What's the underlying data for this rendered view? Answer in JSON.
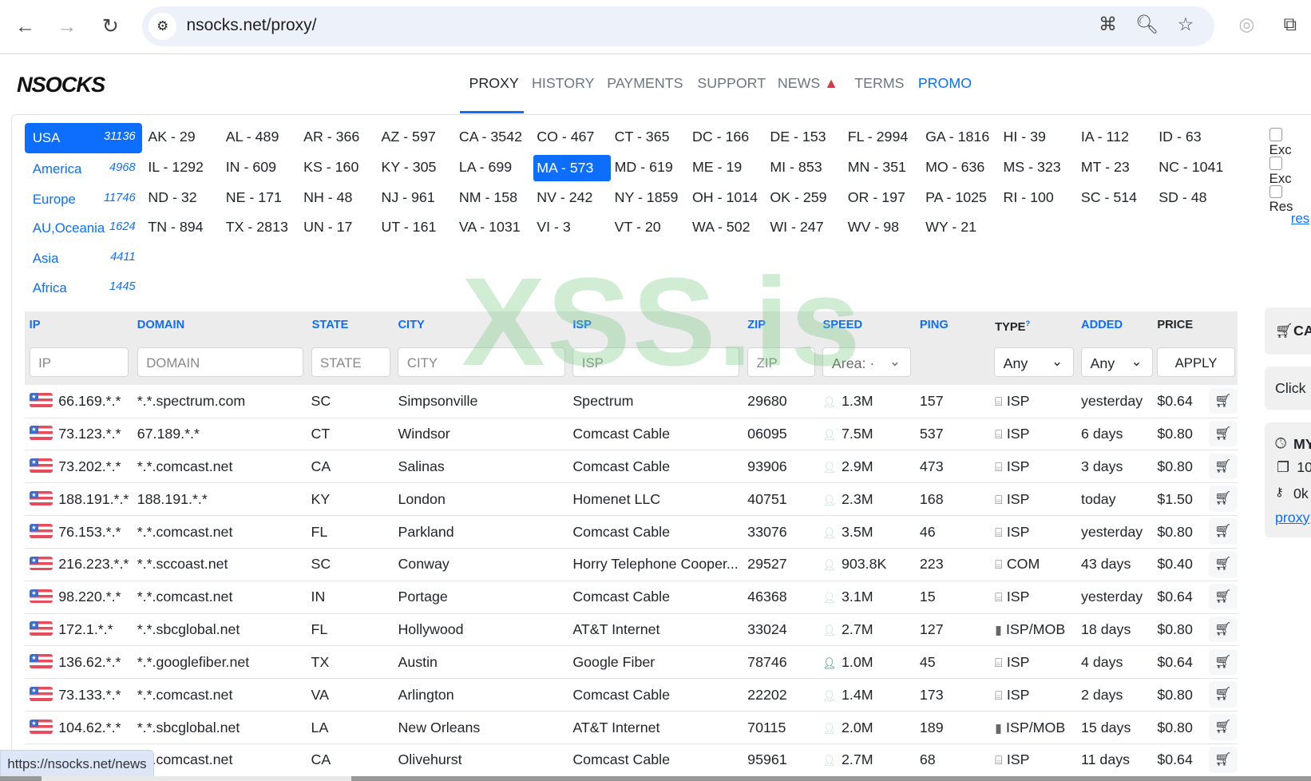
{
  "browser": {
    "url": "nsocks.net/proxy/",
    "status_url": "https://nsocks.net/news"
  },
  "site": {
    "logo": "NSOCKS",
    "nav": [
      "PROXY",
      "HISTORY",
      "PAYMENTS",
      "SUPPORT",
      "NEWS",
      "TERMS",
      "PROMO"
    ]
  },
  "regions": [
    {
      "name": "USA",
      "count": "31136"
    },
    {
      "name": "America",
      "count": "4968"
    },
    {
      "name": "Europe",
      "count": "11746"
    },
    {
      "name": "AU,Oceania",
      "count": "1624"
    },
    {
      "name": "Asia",
      "count": "4411"
    },
    {
      "name": "Africa",
      "count": "1445"
    }
  ],
  "states": [
    "AK - 29",
    "AL - 489",
    "AR - 366",
    "AZ - 597",
    "CA - 3542",
    "CO - 467",
    "CT - 365",
    "DC - 166",
    "DE - 153",
    "FL - 2994",
    "GA - 1816",
    "HI - 39",
    "IA - 112",
    "ID - 63",
    "IL - 1292",
    "IN - 609",
    "KS - 160",
    "KY - 305",
    "LA - 699",
    "MA - 573",
    "MD - 619",
    "ME - 19",
    "MI - 853",
    "MN - 351",
    "MO - 636",
    "MS - 323",
    "MT - 23",
    "NC - 1041",
    "ND - 32",
    "NE - 171",
    "NH - 48",
    "NJ - 961",
    "NM - 158",
    "NV - 242",
    "NY - 1859",
    "OH - 1014",
    "OK - 259",
    "OR - 197",
    "PA - 1025",
    "RI - 100",
    "SC - 514",
    "SD - 48",
    "TN - 894",
    "TX - 2813",
    "UN - 17",
    "UT - 161",
    "VA - 1031",
    "VI - 3",
    "VT - 20",
    "WA - 502",
    "WI - 247",
    "WV - 98",
    "WY - 21"
  ],
  "selected_state": "MA - 573",
  "options": [
    "Exc",
    "Exc",
    "Res"
  ],
  "reset_link": "res",
  "watermark": "XSS.is",
  "table": {
    "headers": {
      "ip": "IP",
      "domain": "DOMAIN",
      "state": "STATE",
      "city": "CITY",
      "isp": "ISP",
      "zip": "ZIP",
      "speed": "SPEED",
      "ping": "PING",
      "type": "TYPE",
      "type_sup": "?",
      "added": "ADDED",
      "price": "PRICE"
    },
    "filters": {
      "ip": "IP",
      "domain": "DOMAIN",
      "state": "STATE",
      "city": "CITY",
      "isp": "ISP",
      "zip": "ZIP",
      "speed": "Area: ·",
      "type": "Any",
      "added": "Any",
      "apply": "APPLY"
    },
    "rows": [
      {
        "ip": "66.169.*.*",
        "domain": "*.*.spectrum.com",
        "state": "SC",
        "city": "Simpsonville",
        "isp": "Spectrum",
        "zip": "29680",
        "speed": "1.3M",
        "ping": "157",
        "type": "ISP",
        "added": "yesterday",
        "price": "$0.64"
      },
      {
        "ip": "73.123.*.*",
        "domain": "67.189.*.*",
        "state": "CT",
        "city": "Windsor",
        "isp": "Comcast Cable",
        "zip": "06095",
        "speed": "7.5M",
        "ping": "537",
        "type": "ISP",
        "added": "6 days",
        "price": "$0.80"
      },
      {
        "ip": "73.202.*.*",
        "domain": "*.*.comcast.net",
        "state": "CA",
        "city": "Salinas",
        "isp": "Comcast Cable",
        "zip": "93906",
        "speed": "2.9M",
        "ping": "473",
        "type": "ISP",
        "added": "3 days",
        "price": "$0.80"
      },
      {
        "ip": "188.191.*.*",
        "domain": "188.191.*.*",
        "state": "KY",
        "city": "London",
        "isp": "Homenet LLC",
        "zip": "40751",
        "speed": "2.3M",
        "ping": "168",
        "type": "ISP",
        "added": "today",
        "price": "$1.50"
      },
      {
        "ip": "76.153.*.*",
        "domain": "*.*.comcast.net",
        "state": "FL",
        "city": "Parkland",
        "isp": "Comcast Cable",
        "zip": "33076",
        "speed": "3.5M",
        "ping": "46",
        "type": "ISP",
        "added": "yesterday",
        "price": "$0.80"
      },
      {
        "ip": "216.223.*.*",
        "domain": "*.*.sccoast.net",
        "state": "SC",
        "city": "Conway",
        "isp": "Horry Telephone Cooper...",
        "zip": "29527",
        "speed": "903.8K",
        "ping": "223",
        "type": "COM",
        "added": "43 days",
        "price": "$0.40"
      },
      {
        "ip": "98.220.*.*",
        "domain": "*.*.comcast.net",
        "state": "IN",
        "city": "Portage",
        "isp": "Comcast Cable",
        "zip": "46368",
        "speed": "3.1M",
        "ping": "15",
        "type": "ISP",
        "added": "yesterday",
        "price": "$0.64"
      },
      {
        "ip": "172.1.*.*",
        "domain": "*.*.sbcglobal.net",
        "state": "FL",
        "city": "Hollywood",
        "isp": "AT&T Internet",
        "zip": "33024",
        "speed": "2.7M",
        "ping": "127",
        "type": "ISP/MOB",
        "added": "18 days",
        "price": "$0.80"
      },
      {
        "ip": "136.62.*.*",
        "domain": "*.*.googlefiber.net",
        "state": "TX",
        "city": "Austin",
        "isp": "Google Fiber",
        "zip": "78746",
        "speed": "1.0M",
        "ping": "45",
        "type": "ISP",
        "added": "4 days",
        "price": "$0.64",
        "speed_active": true
      },
      {
        "ip": "73.133.*.*",
        "domain": "*.*.comcast.net",
        "state": "VA",
        "city": "Arlington",
        "isp": "Comcast Cable",
        "zip": "22202",
        "speed": "1.4M",
        "ping": "173",
        "type": "ISP",
        "added": "2 days",
        "price": "$0.80"
      },
      {
        "ip": "104.62.*.*",
        "domain": "*.*.sbcglobal.net",
        "state": "LA",
        "city": "New Orleans",
        "isp": "AT&T Internet",
        "zip": "70115",
        "speed": "2.0M",
        "ping": "189",
        "type": "ISP/MOB",
        "added": "15 days",
        "price": "$0.80"
      },
      {
        "ip": "",
        "domain": "*.*.comcast.net",
        "state": "CA",
        "city": "Olivehurst",
        "isp": "Comcast Cable",
        "zip": "95961",
        "speed": "2.7M",
        "ping": "68",
        "type": "ISP",
        "added": "11 days",
        "price": "$0.64"
      }
    ]
  },
  "sidebar": {
    "cart": "CA",
    "click": "Click",
    "my": "MY",
    "count": "10",
    "key": "0k",
    "link": "proxy"
  },
  "colors": {
    "accent": "#0d6efd",
    "speed_active": "#1e7a4f",
    "speed_idle": "#b8dcc4"
  }
}
